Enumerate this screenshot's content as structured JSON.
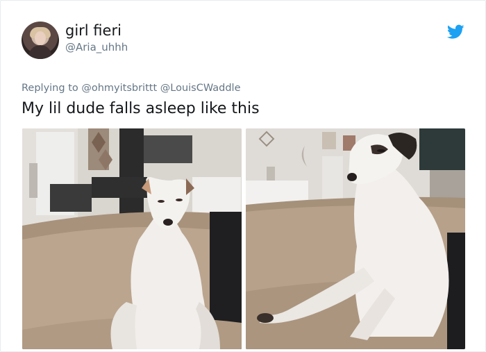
{
  "tweet": {
    "author": {
      "display_name": "girl fieri",
      "handle": "@Aria_uhhh"
    },
    "replying_prefix": "Replying to",
    "replying_mentions": [
      "@ohmyitsbrittt",
      "@LouisCWaddle"
    ],
    "text": "My lil dude falls asleep like this",
    "brand_icon": "twitter-bird-icon",
    "brand_color": "#1da1f2",
    "photos": [
      {
        "icon": "photo-dog-sitting-front"
      },
      {
        "icon": "photo-dog-sitting-side"
      }
    ]
  }
}
